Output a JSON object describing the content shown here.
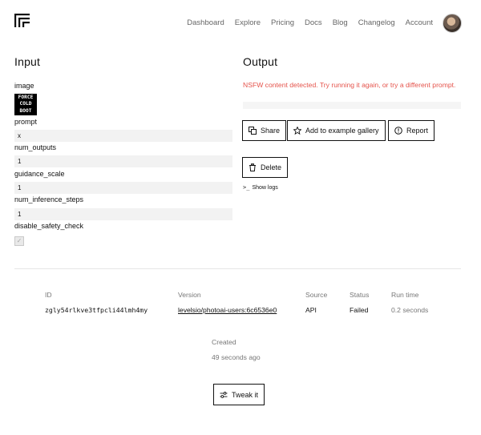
{
  "nav": {
    "items": [
      "Dashboard",
      "Explore",
      "Pricing",
      "Docs",
      "Blog",
      "Changelog",
      "Account"
    ]
  },
  "input": {
    "title": "Input",
    "image_label": "image",
    "image_text": [
      "FORCE",
      "COLD",
      "BOOT"
    ],
    "prompt_label": "prompt",
    "prompt_value": "x",
    "num_outputs_label": "num_outputs",
    "num_outputs_value": "1",
    "guidance_scale_label": "guidance_scale",
    "guidance_scale_value": "1",
    "num_inference_steps_label": "num_inference_steps",
    "num_inference_steps_value": "1",
    "disable_safety_check_label": "disable_safety_check",
    "disable_safety_check_checked": true
  },
  "output": {
    "title": "Output",
    "error_message": "NSFW content detected. Try running it again, or try a different prompt.",
    "share_label": "Share",
    "gallery_label": "Add to example gallery",
    "report_label": "Report",
    "delete_label": "Delete",
    "show_logs_label": "Show logs"
  },
  "prediction": {
    "id_header": "ID",
    "id_value": "zgly54rlkve3tfpcli44lmh4my",
    "version_header": "Version",
    "version_value": "levelsio/photoai-users:6c6536e0",
    "source_header": "Source",
    "source_value": "API",
    "status_header": "Status",
    "status_value": "Failed",
    "runtime_header": "Run time",
    "runtime_value": "0.2 seconds",
    "created_header": "Created",
    "created_value": "49 seconds ago",
    "tweak_label": "Tweak it"
  },
  "colors": {
    "error": "#e5534b",
    "field_bg": "#f2f2f2",
    "muted": "#777777"
  }
}
